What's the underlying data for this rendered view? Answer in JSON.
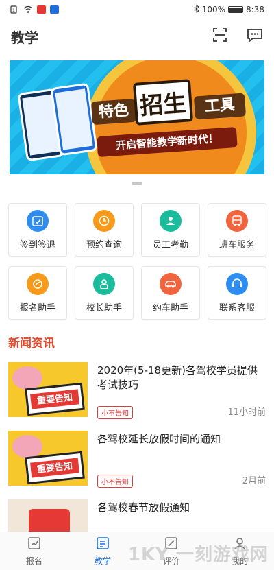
{
  "status_bar": {
    "battery": "100%",
    "time": "8:38"
  },
  "header": {
    "title": "教学",
    "scan_icon": "scan-icon",
    "message_icon": "message-icon"
  },
  "banner": {
    "tag1": "特色",
    "tag2": "招生",
    "tag3": "工具",
    "subtitle": "开启智能教学新时代！"
  },
  "grid": [
    {
      "label": "签到签退",
      "icon": "calendar-check-icon",
      "color": "#2f8cf0"
    },
    {
      "label": "预约查询",
      "icon": "clock-search-icon",
      "color": "#f59a1a"
    },
    {
      "label": "员工考勤",
      "icon": "staff-icon",
      "color": "#1bbc9b"
    },
    {
      "label": "班车服务",
      "icon": "bus-icon",
      "color": "#f0653e"
    },
    {
      "label": "报名助手",
      "icon": "signup-icon",
      "color": "#f59a1a"
    },
    {
      "label": "校长助手",
      "icon": "principal-icon",
      "color": "#1bbc9b"
    },
    {
      "label": "约车助手",
      "icon": "car-icon",
      "color": "#f0653e"
    },
    {
      "label": "联系客服",
      "icon": "support-icon",
      "color": "#2f8cf0"
    }
  ],
  "news": {
    "section_title": "新闻资讯",
    "items": [
      {
        "headline": "2020年(5-18更新)各驾校学员提供考试技巧",
        "tag": "小不告知",
        "time": "11小时前",
        "thumb_text": "重要告知"
      },
      {
        "headline": "各驾校延长放假时间的通知",
        "tag": "小不告知",
        "time": "2月前",
        "thumb_text": "重要告知"
      },
      {
        "headline": "各驾校春节放假通知",
        "tag": "",
        "time": "",
        "thumb_text": ""
      }
    ]
  },
  "tabbar": [
    {
      "label": "报名",
      "icon": "signup-tab-icon",
      "active": false
    },
    {
      "label": "教学",
      "icon": "teaching-tab-icon",
      "active": true
    },
    {
      "label": "评价",
      "icon": "review-tab-icon",
      "active": false
    },
    {
      "label": "我的",
      "icon": "profile-tab-icon",
      "active": false
    }
  ],
  "watermark": "1KY 一刻游戏网"
}
